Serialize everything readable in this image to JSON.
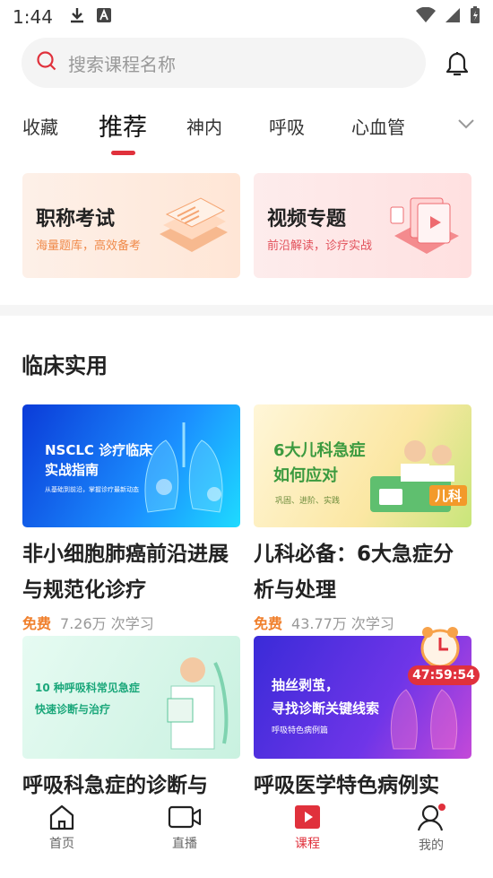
{
  "status": {
    "time": "1:44"
  },
  "search": {
    "placeholder": "搜索课程名称"
  },
  "tabs": [
    {
      "label": "收藏"
    },
    {
      "label": "推荐"
    },
    {
      "label": "神内"
    },
    {
      "label": "呼吸"
    },
    {
      "label": "心血管"
    }
  ],
  "promo": [
    {
      "title": "职称考试",
      "subtitle": "海量题库，高效备考"
    },
    {
      "title": "视频专题",
      "subtitle": "前沿解读，诊疗实战"
    }
  ],
  "section": {
    "title": "临床实用"
  },
  "courses": [
    {
      "thumb_title": "NSCLC 诊疗临床\n实战指南",
      "thumb_sub": "从基础到前沿，掌握诊疗最新动态",
      "title": "非小细胞肺癌前沿进展与规范化诊疗",
      "free": "免费",
      "views": "7.26万 次学习"
    },
    {
      "thumb_title": "6大儿科急症\n如何应对",
      "thumb_sub": "巩固、进阶、实践",
      "thumb_tag": "儿科",
      "title": "儿科必备：6大急症分析与处理",
      "free": "免费",
      "views": "43.77万 次学习"
    },
    {
      "thumb_title": "10 种呼吸科常见急症\n快速诊断与治疗",
      "title": "呼吸科急症的诊断与"
    },
    {
      "thumb_title": "抽丝剥茧，\n寻找诊断关键线索",
      "thumb_sub": "呼吸特色病例篇",
      "title": "呼吸医学特色病例实"
    }
  ],
  "timer": "47:59:54",
  "bottom_nav": [
    {
      "label": "首页"
    },
    {
      "label": "直播"
    },
    {
      "label": "课程"
    },
    {
      "label": "我的"
    }
  ]
}
